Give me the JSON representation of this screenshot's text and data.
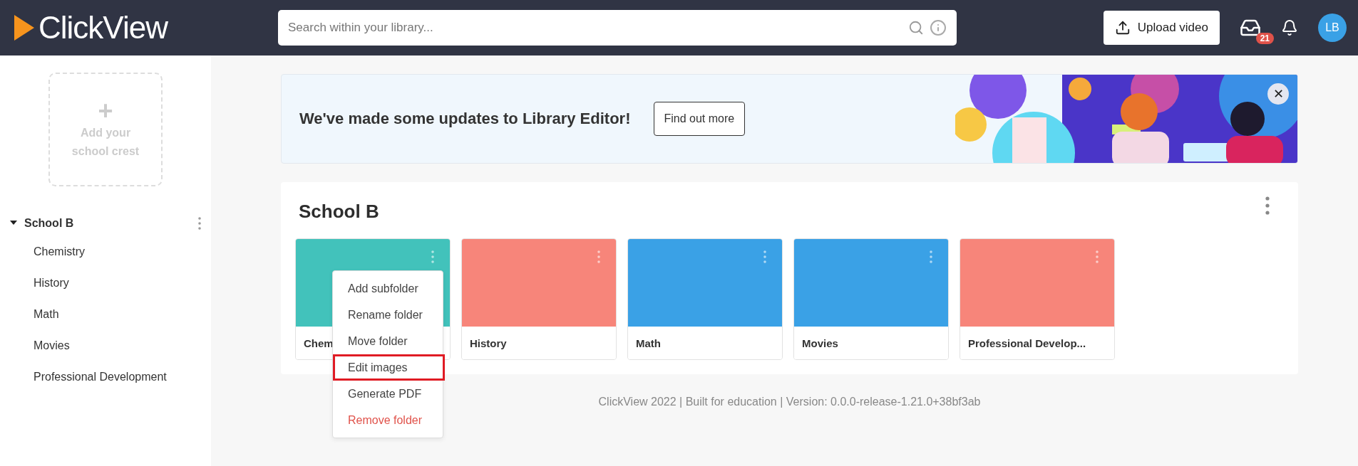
{
  "header": {
    "logo": "Click**View**",
    "search": {
      "placeholder": "Search within your library..."
    },
    "upload_button": "Upload video",
    "inbox_badge": "21",
    "avatar": "LB"
  },
  "sidebar": {
    "crest": {
      "plus": "+",
      "label": "Add your school crest"
    },
    "tree": [
      {
        "label": "School B",
        "expanded": true,
        "children": [
          {
            "label": "Chemistry"
          },
          {
            "label": "History"
          },
          {
            "label": "Math"
          },
          {
            "label": "Movies"
          },
          {
            "label": "Professional Development"
          }
        ]
      }
    ]
  },
  "banner": {
    "text": "We've made some updates to Library Editor!",
    "button": "Find out more",
    "close": "✕"
  },
  "library": {
    "title": "School B",
    "folders": [
      {
        "label": "Chem",
        "color": "#42c2bb"
      },
      {
        "label": "History",
        "color": "#f7857a"
      },
      {
        "label": "Math",
        "color": "#3aa1e6"
      },
      {
        "label": "Movies",
        "color": "#3aa1e6"
      },
      {
        "label": "Professional Develop...",
        "color": "#f7857a"
      }
    ],
    "menu": [
      {
        "label": "Add subfolder",
        "kind": "normal",
        "selected": false
      },
      {
        "label": "Rename folder",
        "kind": "normal",
        "selected": false
      },
      {
        "label": "Move folder",
        "kind": "normal",
        "selected": false
      },
      {
        "label": "Edit images",
        "kind": "normal",
        "selected": true
      },
      {
        "label": "Generate PDF",
        "kind": "normal",
        "selected": false
      },
      {
        "label": "Remove folder",
        "kind": "danger",
        "selected": false
      }
    ]
  },
  "footer": "ClickView 2022 | Built for education | Version: 0.0.0-release-1.21.0+38bf3ab"
}
